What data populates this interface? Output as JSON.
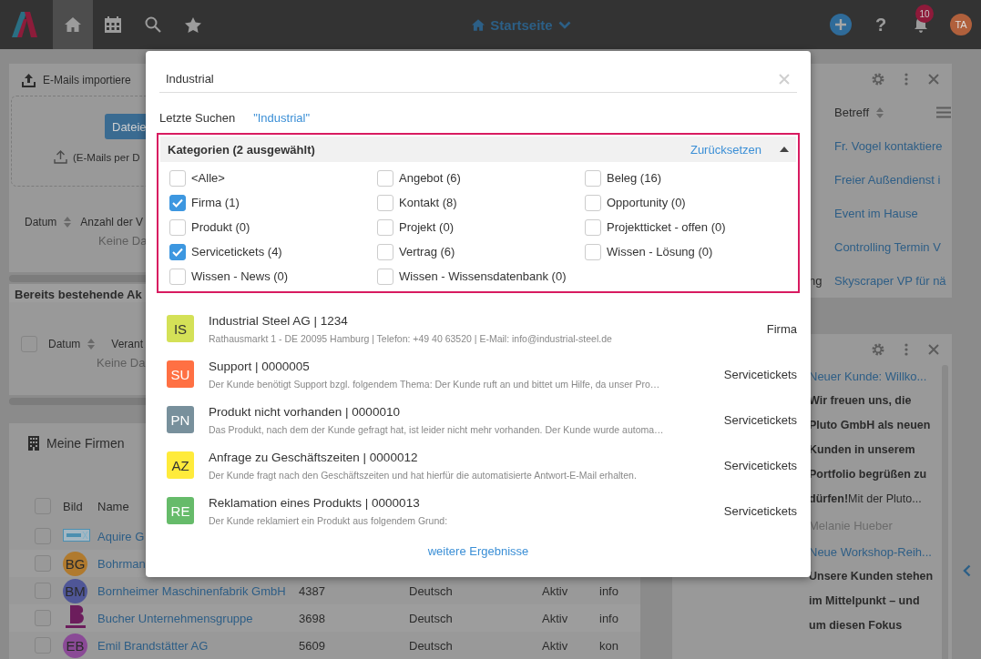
{
  "top_bar": {
    "nav": [
      {
        "kind": "home",
        "selected": true
      },
      {
        "kind": "calendar",
        "selected": false
      },
      {
        "kind": "search",
        "selected": false
      },
      {
        "kind": "favorites",
        "selected": false
      }
    ],
    "page_title": "Startseite",
    "help_label": "?",
    "notification_count": "10",
    "user_initials": "TA"
  },
  "email_import": {
    "title": "E-Mails importiere",
    "button": "Dateie",
    "hint": "(E-Mails per D",
    "columns": [
      "Datum",
      "Anzahl der V"
    ],
    "empty": "Keine Da"
  },
  "existing_activities": {
    "title": "Bereits bestehende Ak",
    "select_all_checked": false,
    "columns": [
      "Datum",
      "Verant"
    ],
    "empty": "Keine Da"
  },
  "companies": {
    "title": "Meine Firmen",
    "select_all_checked": false,
    "columns": [
      "Bild",
      "Name"
    ],
    "rows": [
      {
        "checked": false,
        "image": {
          "kind": "logo"
        },
        "name": "Aquire G"
      },
      {
        "checked": false,
        "image": {
          "kind": "initials",
          "initials": "BG",
          "color": "#b07a2e"
        },
        "name": "Bohrman"
      },
      {
        "checked": false,
        "image": {
          "kind": "initials",
          "initials": "BM",
          "color": "#4f5697"
        },
        "name": "Bornheimer Maschinenfabrik GmbH",
        "number": "4387",
        "language": "Deutsch",
        "status": "Aktiv",
        "column_6": "info"
      },
      {
        "checked": false,
        "image": {
          "kind": "logo"
        },
        "name": "Bucher Unternehmensgruppe",
        "number": "3698",
        "language": "Deutsch",
        "status": "Aktiv",
        "column_6": "info"
      },
      {
        "checked": false,
        "image": {
          "kind": "initials",
          "initials": "EB",
          "color": "#8a4a96"
        },
        "name": "Emil Brandstätter AG",
        "number": "5609",
        "language": "Deutsch",
        "status": "Aktiv",
        "column_6": "kon"
      }
    ]
  },
  "activities": {
    "columns": [
      "Betreff"
    ],
    "rows": [
      {
        "subject": "Fr. Vogel kontaktiere"
      },
      {
        "subject": "Freier Außendienst i"
      },
      {
        "subject": "Event im Hause"
      },
      {
        "subject": "Controlling Termin V"
      },
      {
        "column_1": "ng",
        "subject": "Skyscraper VP für nä"
      }
    ]
  },
  "news": {
    "items": [
      {
        "title": "Neuer Kunde: Willko...",
        "lead": "Wir freuen uns, die Pluto GmbH als neuen Kunden in unserem Portfolio begrüßen zu dürfen!",
        "text": "Mit der Pluto...",
        "author": "Melanie Hueber"
      },
      {
        "title": "Neue Workshop-Reih...",
        "lead": "Unsere Kunden stehen im Mittelpunkt – und um diesen Fokus"
      }
    ]
  },
  "search_dialog": {
    "query": "Industrial",
    "recent_label": "Letzte Suchen",
    "recent": [
      "\"Industrial\""
    ],
    "filter": {
      "title": "Kategorien (2 ausgewählt)",
      "reset": "Zurücksetzen",
      "expanded": true,
      "categories": [
        {
          "label": "<Alle>",
          "checked": false
        },
        {
          "label": "Angebot (6)",
          "checked": false
        },
        {
          "label": "Beleg (16)",
          "checked": false
        },
        {
          "label": "Firma (1)",
          "checked": true
        },
        {
          "label": "Kontakt (8)",
          "checked": false
        },
        {
          "label": "Opportunity (0)",
          "checked": false
        },
        {
          "label": "Produkt (0)",
          "checked": false
        },
        {
          "label": "Projekt (0)",
          "checked": false
        },
        {
          "label": "Projektticket - offen (0)",
          "checked": false
        },
        {
          "label": "Servicetickets (4)",
          "checked": true
        },
        {
          "label": "Vertrag (6)",
          "checked": false
        },
        {
          "label": "Wissen - Lösung (0)",
          "checked": false
        },
        {
          "label": "Wissen - News (0)",
          "checked": false
        },
        {
          "label": "Wissen - Wissensdatenbank (0)",
          "checked": false
        }
      ]
    },
    "results": [
      {
        "initials": "IS",
        "color": "#d4e157",
        "title": "Industrial Steel AG | 1234",
        "subtitle": "Rathausmarkt 1 - DE 20095 Hamburg | Telefon: +49 40 63520 | E-Mail: info@industrial-steel.de",
        "category": "Firma"
      },
      {
        "initials": "SU",
        "color": "#ff7043",
        "title": "Support | 0000005",
        "subtitle": "Der Kunde benötigt Support bzgl. folgendem Thema: Der Kunde ruft an und bittet um Hilfe, da unser Pro…",
        "category": "Servicetickets"
      },
      {
        "initials": "PN",
        "color": "#78909c",
        "title": "Produkt nicht vorhanden | 0000010",
        "subtitle": "Das Produkt, nach dem der Kunde gefragt hat, ist leider nicht mehr vorhanden. Der Kunde wurde automa…",
        "category": "Servicetickets"
      },
      {
        "initials": "AZ",
        "color": "#ffeb3b",
        "title": "Anfrage zu Geschäftszeiten | 0000012",
        "subtitle": "Der Kunde fragt nach den Geschäftszeiten und hat hierfür die automatisierte Antwort-E-Mail erhalten.",
        "category": "Servicetickets"
      },
      {
        "initials": "RE",
        "color": "#66bb6a",
        "title": "Reklamation eines Produkts | 0000013",
        "subtitle": "Der Kunde reklamiert ein Produkt aus folgendem Grund:",
        "category": "Servicetickets"
      }
    ],
    "more": "weitere Ergebnisse"
  }
}
